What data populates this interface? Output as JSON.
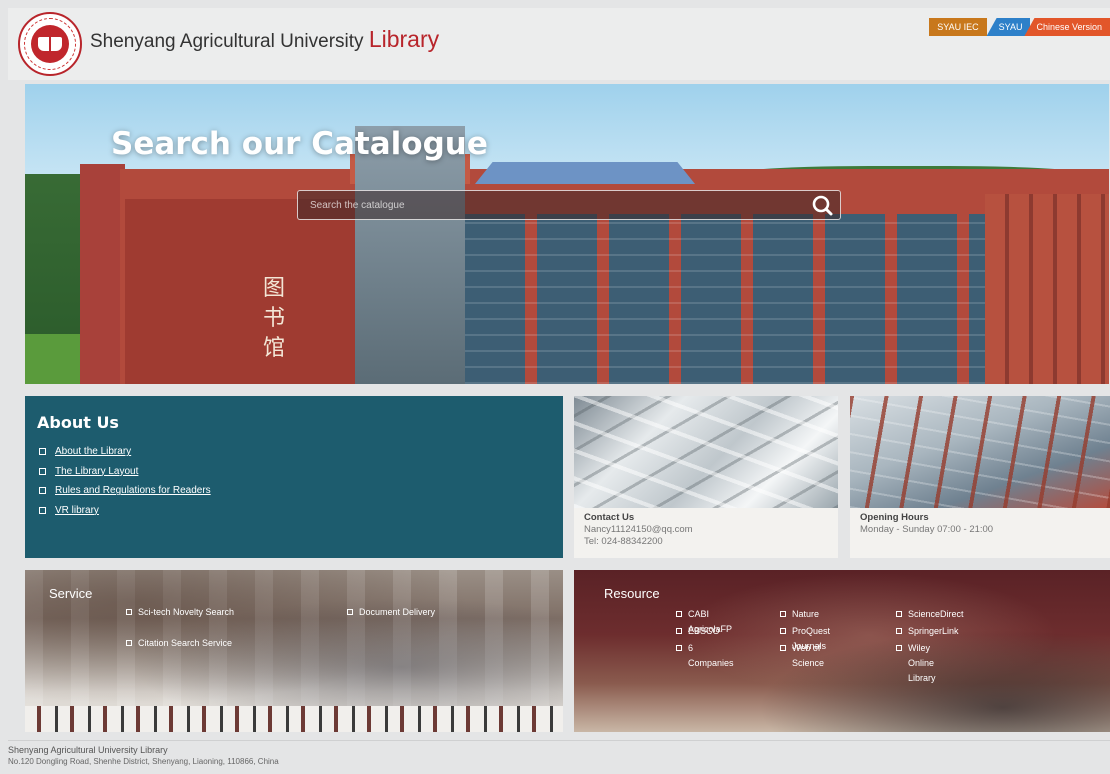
{
  "header": {
    "title_main": "Shenyang Agricultural University",
    "title_accent": "Library",
    "logo_icon": "university-seal-icon",
    "lang_links": [
      {
        "label": "SYAU IEC",
        "color": "#c8781c"
      },
      {
        "label": "SYAU",
        "color": "#2d80c9"
      },
      {
        "label": "Chinese Version",
        "color": "#e2562a"
      }
    ]
  },
  "hero": {
    "title": "Search our Catalogue",
    "search_placeholder": "Search the catalogue",
    "calligraphy": "图书馆"
  },
  "about": {
    "title": "About Us",
    "bg_color": "#1d5c6e",
    "links": [
      "About the Library",
      "The Library Layout",
      "Rules and Regulations for Readers",
      "VR library"
    ]
  },
  "contact": {
    "title": "Contact Us",
    "email": "Nancy11124150@qq.com",
    "tel": "Tel: 024-88342200"
  },
  "hours": {
    "title": "Opening Hours",
    "value": "Monday - Sunday 07:00 - 21:00"
  },
  "service": {
    "title": "Service",
    "links": [
      "Sci-tech Novelty Search",
      "Citation Search Service",
      "Document Delivery"
    ]
  },
  "resource": {
    "title": "Resource",
    "links": [
      "CABI AgricolaFP",
      "EBSCO",
      "6 Companies",
      "Nature",
      "ProQuest Journals",
      "Web of Science",
      "ScienceDirect",
      "SpringerLink",
      "Wiley Online Library"
    ]
  },
  "footer": {
    "name": "Shenyang Agricultural University Library",
    "address": "No.120 Dongling Road, Shenhe District, Shenyang, Liaoning, 110866, China"
  }
}
